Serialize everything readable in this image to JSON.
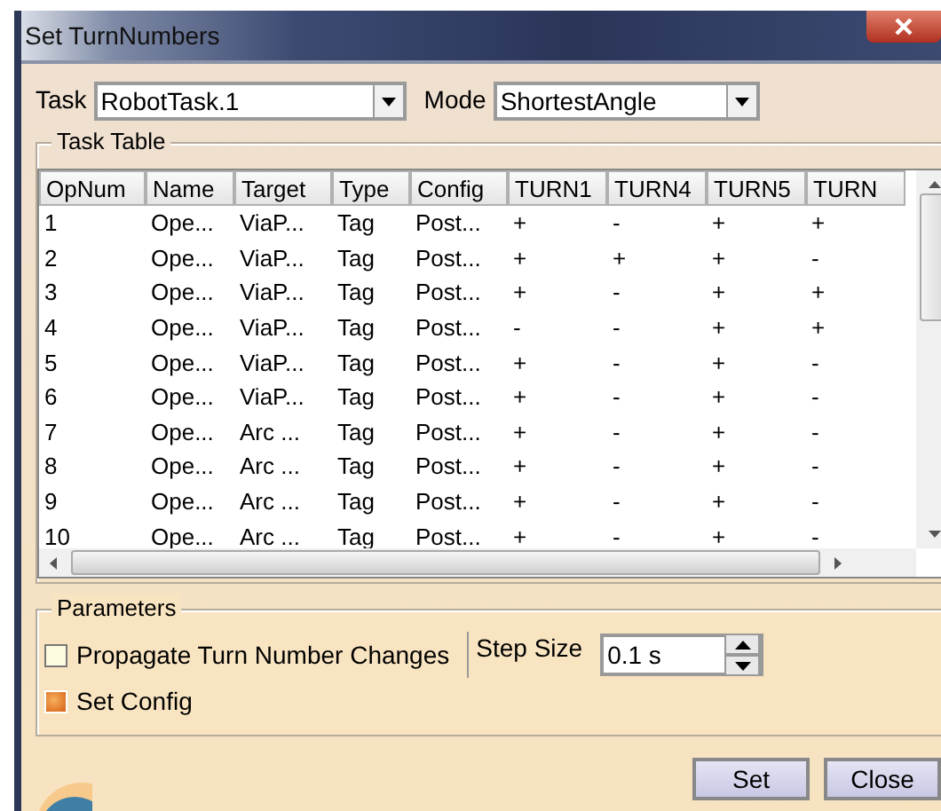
{
  "window": {
    "title": "Set TurnNumbers"
  },
  "task": {
    "label": "Task",
    "value": "RobotTask.1"
  },
  "mode": {
    "label": "Mode",
    "value": "ShortestAngle"
  },
  "task_table": {
    "title": "Task Table",
    "columns": [
      "OpNum",
      "Name",
      "Target",
      "Type",
      "Config",
      "TURN1",
      "TURN4",
      "TURN5",
      "TURN"
    ],
    "rows": [
      [
        "1",
        "Ope...",
        "ViaP...",
        "Tag",
        "Post...",
        "+",
        "-",
        "+",
        "+"
      ],
      [
        "2",
        "Ope...",
        "ViaP...",
        "Tag",
        "Post...",
        "+",
        "+",
        "+",
        "-"
      ],
      [
        "3",
        "Ope...",
        "ViaP...",
        "Tag",
        "Post...",
        "+",
        "-",
        "+",
        "+"
      ],
      [
        "4",
        "Ope...",
        "ViaP...",
        "Tag",
        "Post...",
        "-",
        "-",
        "+",
        "+"
      ],
      [
        "5",
        "Ope...",
        "ViaP...",
        "Tag",
        "Post...",
        "+",
        "-",
        "+",
        "-"
      ],
      [
        "6",
        "Ope...",
        "ViaP...",
        "Tag",
        "Post...",
        "+",
        "-",
        "+",
        "-"
      ],
      [
        "7",
        "Ope...",
        "Arc ...",
        "Tag",
        "Post...",
        "+",
        "-",
        "+",
        "-"
      ],
      [
        "8",
        "Ope...",
        "Arc ...",
        "Tag",
        "Post...",
        "+",
        "-",
        "+",
        "-"
      ],
      [
        "9",
        "Ope...",
        "Arc ...",
        "Tag",
        "Post...",
        "+",
        "-",
        "+",
        "-"
      ],
      [
        "10",
        "Ope...",
        "Arc ...",
        "Tag",
        "Post...",
        "+",
        "-",
        "+",
        "-"
      ]
    ]
  },
  "parameters": {
    "title": "Parameters",
    "propagate": {
      "label": "Propagate Turn Number Changes",
      "checked": false
    },
    "step_size": {
      "label": "Step Size",
      "value": "0.1 s"
    },
    "set_config": {
      "label": "Set Config",
      "checked": true
    }
  },
  "buttons": [
    "Set",
    "Close"
  ]
}
